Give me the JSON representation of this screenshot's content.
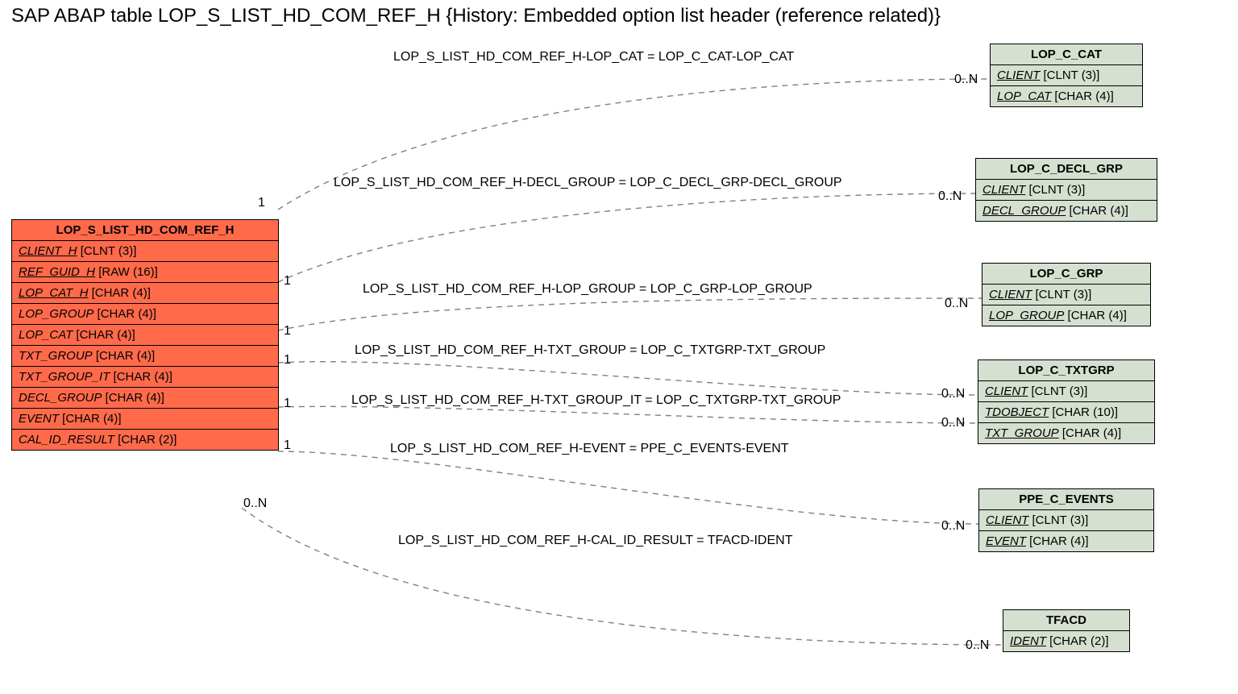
{
  "title": "SAP ABAP table LOP_S_LIST_HD_COM_REF_H {History: Embedded option list header (reference related)}",
  "main_entity": {
    "name": "LOP_S_LIST_HD_COM_REF_H",
    "fields": [
      {
        "name": "CLIENT_H",
        "type": "[CLNT (3)]",
        "underline": true
      },
      {
        "name": "REF_GUID_H",
        "type": "[RAW (16)]",
        "underline": true
      },
      {
        "name": "LOP_CAT_H",
        "type": "[CHAR (4)]",
        "underline": true
      },
      {
        "name": "LOP_GROUP",
        "type": "[CHAR (4)]",
        "underline": false
      },
      {
        "name": "LOP_CAT",
        "type": "[CHAR (4)]",
        "underline": false
      },
      {
        "name": "TXT_GROUP",
        "type": "[CHAR (4)]",
        "underline": false
      },
      {
        "name": "TXT_GROUP_IT",
        "type": "[CHAR (4)]",
        "underline": false
      },
      {
        "name": "DECL_GROUP",
        "type": "[CHAR (4)]",
        "underline": false
      },
      {
        "name": "EVENT",
        "type": "[CHAR (4)]",
        "underline": false
      },
      {
        "name": "CAL_ID_RESULT",
        "type": "[CHAR (2)]",
        "underline": false
      }
    ]
  },
  "ref_entities": [
    {
      "name": "LOP_C_CAT",
      "fields": [
        {
          "name": "CLIENT",
          "type": "[CLNT (3)]",
          "underline": true
        },
        {
          "name": "LOP_CAT",
          "type": "[CHAR (4)]",
          "underline": true
        }
      ]
    },
    {
      "name": "LOP_C_DECL_GRP",
      "fields": [
        {
          "name": "CLIENT",
          "type": "[CLNT (3)]",
          "underline": true
        },
        {
          "name": "DECL_GROUP",
          "type": "[CHAR (4)]",
          "underline": true
        }
      ]
    },
    {
      "name": "LOP_C_GRP",
      "fields": [
        {
          "name": "CLIENT",
          "type": "[CLNT (3)]",
          "underline": true
        },
        {
          "name": "LOP_GROUP",
          "type": "[CHAR (4)]",
          "underline": true
        }
      ]
    },
    {
      "name": "LOP_C_TXTGRP",
      "fields": [
        {
          "name": "CLIENT",
          "type": "[CLNT (3)]",
          "underline": true
        },
        {
          "name": "TDOBJECT",
          "type": "[CHAR (10)]",
          "underline": true
        },
        {
          "name": "TXT_GROUP",
          "type": "[CHAR (4)]",
          "underline": true
        }
      ]
    },
    {
      "name": "PPE_C_EVENTS",
      "fields": [
        {
          "name": "CLIENT",
          "type": "[CLNT (3)]",
          "underline": true
        },
        {
          "name": "EVENT",
          "type": "[CHAR (4)]",
          "underline": true
        }
      ]
    },
    {
      "name": "TFACD",
      "fields": [
        {
          "name": "IDENT",
          "type": "[CHAR (2)]",
          "underline": true
        }
      ]
    }
  ],
  "relations": [
    {
      "label": "LOP_S_LIST_HD_COM_REF_H-LOP_CAT = LOP_C_CAT-LOP_CAT"
    },
    {
      "label": "LOP_S_LIST_HD_COM_REF_H-DECL_GROUP = LOP_C_DECL_GRP-DECL_GROUP"
    },
    {
      "label": "LOP_S_LIST_HD_COM_REF_H-LOP_GROUP = LOP_C_GRP-LOP_GROUP"
    },
    {
      "label": "LOP_S_LIST_HD_COM_REF_H-TXT_GROUP = LOP_C_TXTGRP-TXT_GROUP"
    },
    {
      "label": "LOP_S_LIST_HD_COM_REF_H-TXT_GROUP_IT = LOP_C_TXTGRP-TXT_GROUP"
    },
    {
      "label": "LOP_S_LIST_HD_COM_REF_H-EVENT = PPE_C_EVENTS-EVENT"
    },
    {
      "label": "LOP_S_LIST_HD_COM_REF_H-CAL_ID_RESULT = TFACD-IDENT"
    }
  ],
  "card_left": [
    "1",
    "1",
    "1",
    "1",
    "1",
    "1",
    "0..N"
  ],
  "card_right": [
    "0..N",
    "0..N",
    "0..N",
    "0..N",
    "0..N",
    "0..N",
    "0..N"
  ]
}
